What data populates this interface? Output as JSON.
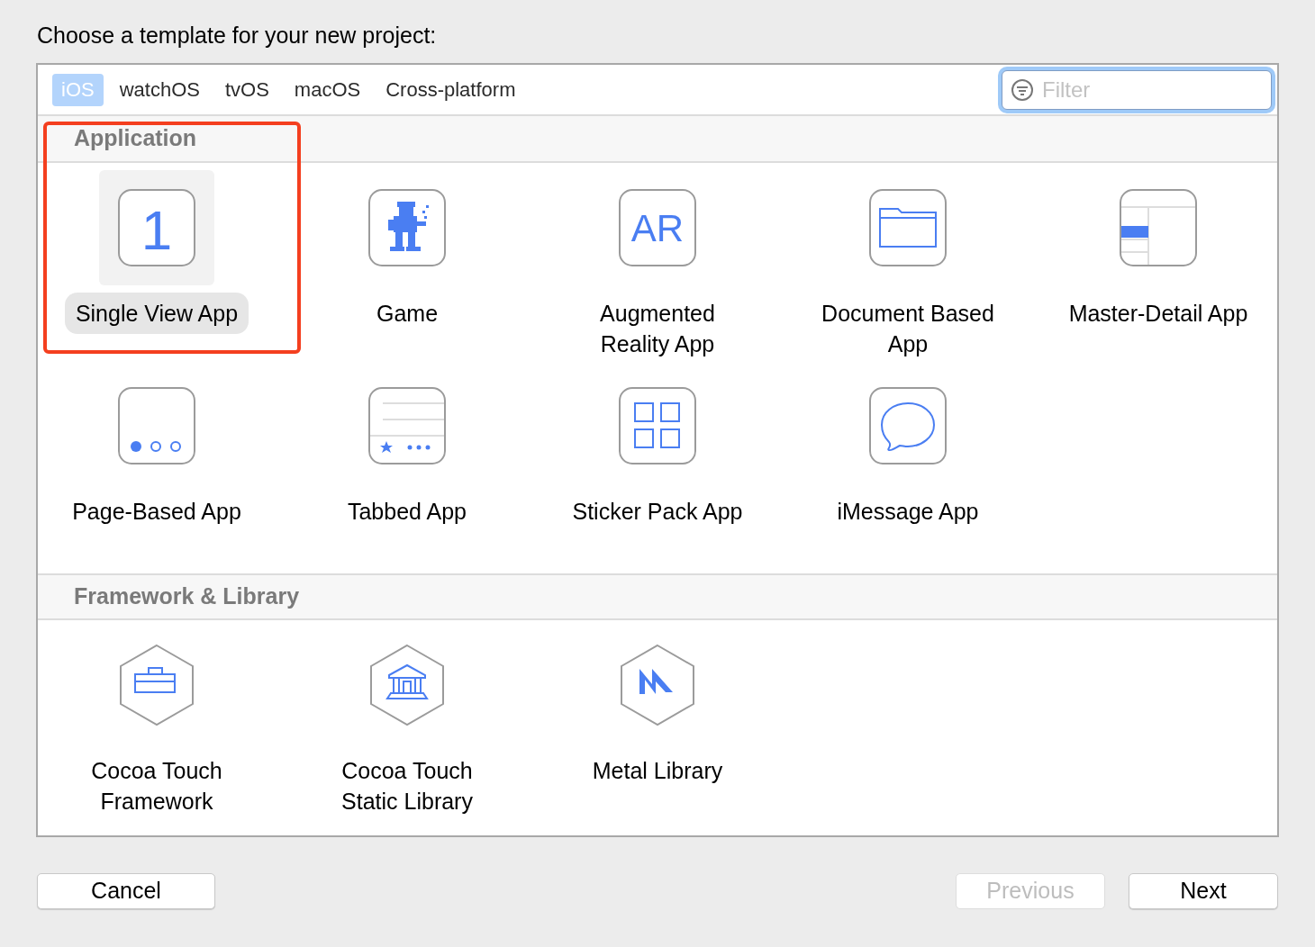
{
  "title": "Choose a template for your new project:",
  "tabs": [
    {
      "label": "iOS",
      "selected": true
    },
    {
      "label": "watchOS",
      "selected": false
    },
    {
      "label": "tvOS",
      "selected": false
    },
    {
      "label": "macOS",
      "selected": false
    },
    {
      "label": "Cross-platform",
      "selected": false
    }
  ],
  "filter": {
    "placeholder": "Filter",
    "focused": true
  },
  "sections": [
    {
      "title": "Application",
      "kind": "rounded",
      "items": [
        {
          "label": "Single View App",
          "selected": true,
          "icon_text": "1"
        },
        {
          "label": "Game",
          "selected": false
        },
        {
          "label": "Augmented\nReality App",
          "selected": false,
          "icon_text": "AR"
        },
        {
          "label": "Document Based\nApp",
          "selected": false
        },
        {
          "label": "Master-Detail App",
          "selected": false
        },
        {
          "label": "Page-Based App",
          "selected": false
        },
        {
          "label": "Tabbed App",
          "selected": false
        },
        {
          "label": "Sticker Pack App",
          "selected": false
        },
        {
          "label": "iMessage App",
          "selected": false
        }
      ]
    },
    {
      "title": "Framework & Library",
      "kind": "hexagon",
      "items": [
        {
          "label": "Cocoa Touch\nFramework",
          "selected": false
        },
        {
          "label": "Cocoa Touch\nStatic Library",
          "selected": false
        },
        {
          "label": "Metal Library",
          "selected": false
        }
      ]
    }
  ],
  "annotation": {
    "kind": "frame"
  },
  "buttons": [
    {
      "label": "Cancel",
      "disabled": false,
      "kind": "left"
    },
    {
      "label": "Previous",
      "disabled": true,
      "kind": "right"
    },
    {
      "label": "Next",
      "disabled": false,
      "kind": "right"
    }
  ]
}
